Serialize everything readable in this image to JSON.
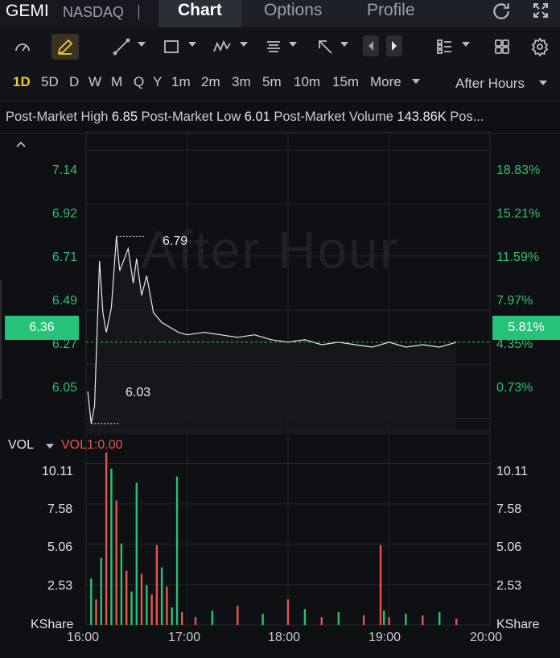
{
  "header": {
    "symbol": "GEMI",
    "exchange": "NASDAQ",
    "tabs": [
      "Chart",
      "Options",
      "Profile"
    ],
    "active_tab": "Chart"
  },
  "toolbar": {
    "icons": [
      "gauge-icon",
      "pencil-icon",
      "line-draw-icon",
      "rectangle-icon",
      "pattern-icon",
      "text-lines-icon",
      "arrow-icon",
      "prev-icon",
      "next-icon",
      "list-icon",
      "grid-icon",
      "gear-icon"
    ]
  },
  "periods": {
    "items": [
      "1D",
      "5D",
      "D",
      "W",
      "M",
      "Q",
      "Y",
      "1m",
      "2m",
      "3m",
      "5m",
      "10m",
      "15m"
    ],
    "active": "1D",
    "more_label": "More",
    "session_label": "After Hours"
  },
  "stats": {
    "high_label": "Post-Market High",
    "high_value": "6.85",
    "low_label": "Post-Market Low",
    "low_value": "6.01",
    "volume_label": "Post-Market Volume",
    "volume_value": "143.86K",
    "overflow": "Pos..."
  },
  "price_chart": {
    "watermark": "After Hour",
    "left_ticks": [
      "7.14",
      "6.92",
      "6.71",
      "6.49",
      "6.27",
      "6.05"
    ],
    "right_ticks": [
      "18.83%",
      "15.21%",
      "11.59%",
      "7.97%",
      "4.35%",
      "0.73%"
    ],
    "current_price": "6.36",
    "current_percent": "5.81%",
    "high_marker": "6.79",
    "low_marker": "6.03"
  },
  "volume_chart": {
    "label": "VOL",
    "indicator": "VOL1:0.00",
    "ticks": [
      "10.11",
      "7.58",
      "5.06",
      "2.53"
    ],
    "footer_left": "KShare",
    "footer_right": "KShare"
  },
  "time_axis": [
    "16:00",
    "17:00",
    "18:00",
    "19:00",
    "20:00"
  ],
  "colors": {
    "accent": "#f0c63b",
    "up": "#27c27a",
    "down": "#e5574f"
  },
  "chart_data": {
    "type": "line",
    "x": [
      "16:01",
      "16:03",
      "16:05",
      "16:08",
      "16:10",
      "16:12",
      "16:15",
      "16:18",
      "16:20",
      "16:25",
      "16:28",
      "16:30",
      "16:33",
      "16:36",
      "16:40",
      "16:45",
      "16:50",
      "16:55",
      "17:00",
      "17:10",
      "17:20",
      "17:30",
      "17:40",
      "17:50",
      "18:00",
      "18:10",
      "18:20",
      "18:30",
      "18:40",
      "18:50",
      "19:00",
      "19:10",
      "19:20",
      "19:30",
      "19:40"
    ],
    "y": [
      6.16,
      6.03,
      6.1,
      6.69,
      6.48,
      6.4,
      6.5,
      6.79,
      6.65,
      6.74,
      6.6,
      6.7,
      6.55,
      6.63,
      6.48,
      6.44,
      6.42,
      6.4,
      6.39,
      6.4,
      6.39,
      6.38,
      6.39,
      6.37,
      6.36,
      6.37,
      6.35,
      6.36,
      6.35,
      6.34,
      6.36,
      6.34,
      6.35,
      6.34,
      6.36
    ],
    "ylim": [
      6.0,
      7.2
    ],
    "volume": {
      "x": [
        "16:03",
        "16:06",
        "16:09",
        "16:12",
        "16:15",
        "16:18",
        "16:21",
        "16:24",
        "16:27",
        "16:30",
        "16:33",
        "16:36",
        "16:39",
        "16:42",
        "16:45",
        "16:48",
        "16:51",
        "16:54",
        "16:57",
        "17:05",
        "17:15",
        "17:30",
        "17:45",
        "18:00",
        "18:10",
        "18:20",
        "18:30",
        "18:45",
        "18:55",
        "18:57",
        "19:00",
        "19:10",
        "19:20",
        "19:30",
        "19:40"
      ],
      "values": [
        2.9,
        1.6,
        4.2,
        10.8,
        9.8,
        7.8,
        5.1,
        3.4,
        2.1,
        8.9,
        3.2,
        2.5,
        1.9,
        5.0,
        3.6,
        2.4,
        1.1,
        9.3,
        0.8,
        0.5,
        0.9,
        1.2,
        0.7,
        1.6,
        1.0,
        0.5,
        0.8,
        0.6,
        5.0,
        0.9,
        0.5,
        0.7,
        0.6,
        0.8,
        0.4
      ],
      "directions": [
        "up",
        "down",
        "up",
        "down",
        "up",
        "down",
        "up",
        "down",
        "up",
        "up",
        "down",
        "up",
        "down",
        "down",
        "up",
        "down",
        "up",
        "up",
        "down",
        "down",
        "up",
        "down",
        "up",
        "down",
        "up",
        "down",
        "up",
        "down",
        "down",
        "up",
        "down",
        "up",
        "down",
        "up",
        "down"
      ],
      "ylim": [
        0,
        11.5
      ]
    }
  }
}
